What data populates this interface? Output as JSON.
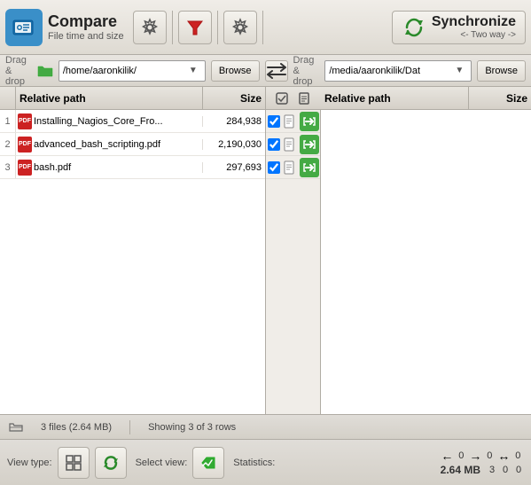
{
  "toolbar": {
    "brand_title": "Compare",
    "brand_subtitle": "File time and size",
    "settings_label": "⚙",
    "filter_label": "▼",
    "gear2_label": "⚙",
    "sync_title": "Synchronize",
    "sync_sub": "<- Two way ->"
  },
  "path_bar": {
    "drag_drop_left": "Drag & drop",
    "drag_drop_right": "Drag & drop",
    "path_left": "/home/aaronkilik/",
    "path_right": "/media/aaronkilik/Dat",
    "browse_label": "Browse",
    "swap_icon": "⇄"
  },
  "table": {
    "header": {
      "col_path": "Relative path",
      "col_size": "Size"
    },
    "rows": [
      {
        "num": "1",
        "name": "Installing_Nagios_Core_Fro...",
        "size": "284,938"
      },
      {
        "num": "2",
        "name": "advanced_bash_scripting.pdf",
        "size": "2,190,030"
      },
      {
        "num": "3",
        "name": "bash.pdf",
        "size": "297,693"
      }
    ]
  },
  "right_table": {
    "header": {
      "col_path": "Relative path",
      "col_size": "Size"
    }
  },
  "status_bar": {
    "files_info": "3 files (2.64 MB)",
    "showing_info": "Showing 3 of 3 rows"
  },
  "bottom_bar": {
    "view_type_label": "View type:",
    "select_view_label": "Select view:",
    "statistics_label": "Statistics:"
  },
  "stats": {
    "val1": "0",
    "val2": "0",
    "val3": "0",
    "val_mb": "2.64 MB",
    "val4": "3",
    "val5": "0",
    "val6": "0"
  }
}
